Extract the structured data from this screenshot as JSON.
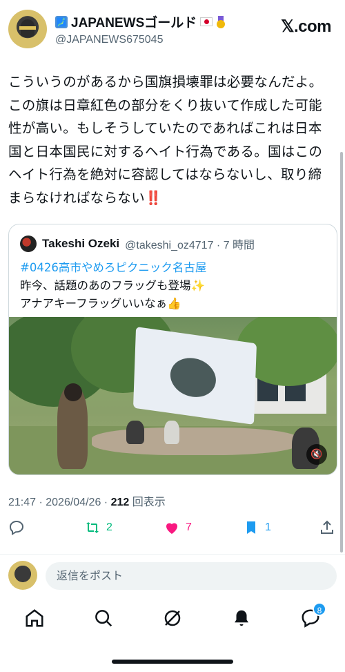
{
  "header": {
    "display_name": "JAPANEWSゴールド",
    "handle": "@JAPANEWS675045",
    "brand": "𝕏.com"
  },
  "tweet": {
    "lines": [
      "こういうのがあるから国旗損壊罪は必要なんだよ。",
      "この旗は日章紅色の部分をくり抜いて作成した可能",
      "性が高い。もしそうしていたのであればこれは日本",
      "国と日本国民に対するヘイト行為である。国はこの",
      "ヘイト行為を絶対に容認してはならないし、取り締",
      "まらなければならない"
    ],
    "emphasis": "‼️"
  },
  "quote": {
    "name": "Takeshi Ozeki",
    "handle_time": "@takeshi_oz4717 · 7 時間",
    "hashtag": "#0426高市やめろピクニック名古屋",
    "line2": "昨今、話題のあのフラッグも登場",
    "line2_emoji": "✨",
    "line3": "アナアキーフラッグいいなぁ",
    "line3_emoji": "👍"
  },
  "meta": {
    "time": "21:47 · 2026/04/26 · ",
    "views_count": "212",
    "views_label": " 回表示"
  },
  "actions": {
    "reply": "",
    "retweets": "2",
    "likes": "7",
    "bookmarks": "1"
  },
  "reply_bar": {
    "placeholder": "返信をポスト"
  },
  "nav": {
    "messages_badge": "8"
  },
  "colors": {
    "accent": "#1d9bf0",
    "retweet": "#00ba7c",
    "like": "#f91880",
    "bookmark": "#1d9bf0",
    "muted_text": "#536471"
  }
}
